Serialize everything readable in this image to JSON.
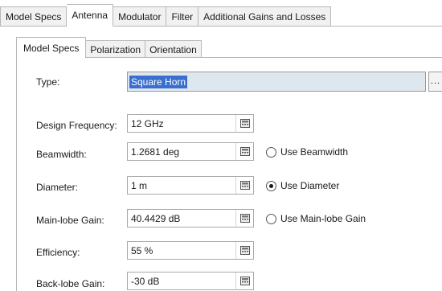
{
  "top_tabs": [
    {
      "label": "Model Specs",
      "active": false
    },
    {
      "label": "Antenna",
      "active": true
    },
    {
      "label": "Modulator",
      "active": false
    },
    {
      "label": "Filter",
      "active": false
    },
    {
      "label": "Additional Gains and Losses",
      "active": false
    }
  ],
  "sub_tabs": [
    {
      "label": "Model Specs",
      "active": true
    },
    {
      "label": "Polarization",
      "active": false
    },
    {
      "label": "Orientation",
      "active": false
    }
  ],
  "type": {
    "label": "Type:",
    "value": "Square Horn",
    "browse_label": "..."
  },
  "fields": {
    "design_frequency": {
      "label": "Design Frequency:",
      "value": "12 GHz"
    },
    "beamwidth": {
      "label": "Beamwidth:",
      "value": "1.2681 deg"
    },
    "diameter": {
      "label": "Diameter:",
      "value": "1 m"
    },
    "main_lobe_gain": {
      "label": "Main-lobe Gain:",
      "value": "40.4429 dB"
    },
    "efficiency": {
      "label": "Efficiency:",
      "value": "55 %"
    },
    "back_lobe_gain": {
      "label": "Back-lobe Gain:",
      "value": "-30 dB"
    }
  },
  "radios": {
    "use_beamwidth": {
      "label": "Use Beamwidth",
      "selected": false
    },
    "use_diameter": {
      "label": "Use Diameter",
      "selected": true
    },
    "use_main_lobe_gain": {
      "label": "Use Main-lobe Gain",
      "selected": false
    }
  },
  "icons": {
    "field_button": "calculator-icon"
  }
}
